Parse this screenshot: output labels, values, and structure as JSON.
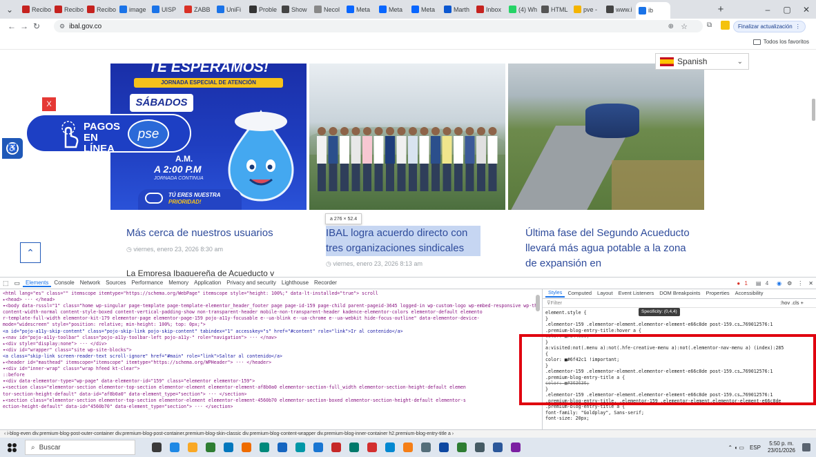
{
  "browser": {
    "tabs": [
      "Recibo",
      "Recibo",
      "Recibo",
      "image",
      "UISP",
      "ZABB",
      "UniFi",
      "Proble",
      "Show",
      "Necol",
      "Meta",
      "Meta",
      "Meta",
      "Marth",
      "Inbox",
      "(4) Wh",
      "HTML",
      "pve -",
      "www.i",
      "ib"
    ],
    "address": "ibal.gov.co",
    "update_button": "Finalizar actualización",
    "bookmarks_label": "Todos los favoritos"
  },
  "page": {
    "language_select": "Spanish",
    "close_badge": "X",
    "banner": {
      "headline_top": "TE ESPERAMOS!",
      "ribbon": "JORNADA ESPECIAL DE ATENCIÓN",
      "day": "SÁBADOS",
      "payments": "PAGOS EN LÍNEA",
      "pse": "pse",
      "time_am": "A.M.",
      "time_pm": "A 2:00 P.M",
      "continuous": "JORNADA CONTINUA",
      "priority_line1": "TÚ ERES NUESTRA",
      "priority_line2": "PRIORIDAD!"
    },
    "size_tooltip": "a  276 × 52.4",
    "posts": [
      {
        "title": "Más cerca de nuestros usuarios",
        "date": "viernes, enero 23, 2026 8:30 am",
        "excerpt": "La Empresa Ibaguereña de Acueducto y"
      },
      {
        "title": "IBAL logra acuerdo directo con tres organizaciones sindicales",
        "date": "viernes, enero 23, 2026 8:13 am"
      },
      {
        "title": "Última fase del Segundo Acueducto llevará más agua potable a la zona de expansión en",
        "date": ""
      }
    ]
  },
  "devtools": {
    "tabs": [
      "Elements",
      "Console",
      "Network",
      "Sources",
      "Performance",
      "Memory",
      "Application",
      "Privacy and security",
      "Lighthouse",
      "Recorder"
    ],
    "badges": {
      "errors": "1",
      "warnings": "4"
    },
    "dom_lines": [
      "<html lang=\"es\" class=\"\" itemscope itemtype=\"https://schema.org/WebPage\" itemscope style=\"height: 100%;\" data-lt-installed=\"true\"> scroll",
      "▸<head> ··· </head>",
      "▾<body data-rsssl=\"1\" class=\"home wp-singular page-template page-template-elementor_header_footer page page-id-159 page-child parent-pageid-3645 logged-in wp-custom-logo wp-embed-responsive wp-theme-kadence ehf-header ehf-footer ehf-template-kadence ehf-stylesheet-kadence social-brand-colors link-style-standard has-sidebar content-title-style-above",
      "content-width-normal content-style-boxed content-vertical-padding-show non-transparent-header mobile-non-transparent-header kadence-elementor-colors elementor-default elemento",
      "r-template-full-width elementor-kit-179 elementor-page elementor-page-159 pojo-a11y-focusable e--ua-blink e--ua-chrome e--ua-webkit hide-focus-outline\" data-elementor-device-",
      "mode=\"widescreen\" style=\"position: relative; min-height: 100%; top: 0px;\">",
      "  <a id=\"pojo-a11y-skip-content\" class=\"pojo-skip-link pojo-skip-content\" tabindex=\"1\" accesskey=\"s\" href=\"#content\" role=\"link\">Ir al contenido</a>",
      "  ▸<nav id=\"pojo-a11y-toolbar\" class=\"pojo-a11y-toolbar-left pojo-a11y-\" role=\"navigation\"> ··· </nav>",
      "  ▸<div style=\"display:none\"> ··· </div>",
      "  ▾<div id=\"wrapper\" class=\"site wp-site-blocks\">",
      "     <a class=\"skip-link screen-reader-text scroll-ignore\" href=\"#main\" role=\"link\">Saltar al contenido</a>",
      "    ▸<header id=\"masthead\" itemscope=\"itemscope\" itemtype=\"https://schema.org/WPHeader\"> ··· </header>",
      "    ▾<div id=\"inner-wrap\" class=\"wrap hfeed kt-clear\">",
      "       ::before",
      "      ▾<div data-elementor-type=\"wp-page\" data-elementor-id=\"159\" class=\"elementor elementor-159\">",
      "        ▸<section class=\"elementor-section elementor-top-section elementor-element elementor-element-af8b0a0 elementor-section-full_width elementor-section-height-default elemen",
      "          tor-section-height-default\" data-id=\"af8b0a0\" data-element_type=\"section\"> ··· </section>",
      "        ▸<section class=\"elementor-section elementor-top-section elementor-element elementor-element-4560b70 elementor-section-boxed elementor-section-height-default elementor-s",
      "          ection-height-default\" data-id=\"4560b70\" data-element_type=\"section\"> ··· </section>"
    ],
    "styles_tabs": [
      "Styles",
      "Computed",
      "Layout",
      "Event Listeners",
      "DOM Breakpoints",
      "Properties",
      "Accessibility"
    ],
    "filter_placeholder": "Filter",
    "filter_tools": ":hov .cls +",
    "styles_lines": [
      "element.style {",
      "}",
      ".elementor-159 .elementor-element.elementor-element-e66c8de   post-159.cs…769012576:1",
      ".premium-blog-entry-title:hover a {",
      "  color: ■#344080;",
      "}",
      "a:visited:not(.menu a):not(.hfe-creative-menu a):not(.elementor-nav-menu a)   (index):285",
      "{",
      "  color: ■#6f42c1 !important;",
      "}",
      ".elementor-159 .elementor-element.elementor-element-e66c8de   post-159.cs…769012576:1",
      ".premium-blog-entry-title a {",
      "  color: ■#363636;",
      "}",
      ".elementor-159 .elementor-element.elementor-element-e66c8de   post-159.cs…769012576:1",
      ".premium-blog-entry-title, .elementor-159 .elementor-element.elementor-element-e66c8de",
      ".premium-blog-entry-title a {",
      "  font-family: \"Goldplay\", Sans-serif;",
      "  font-size: 20px;"
    ],
    "specificity_tooltip": "Specificity: (0,4,4)",
    "breadcrumbs": "‹ i-blog-even   div.premium-blog-post-outer-container   div.premium-blog-post-container.premium-blog-skin-classic   div.premium-blog-content-wrapper   div.premium-blog-inner-container   h2.premium-blog-entry-title   a ›"
  },
  "taskbar": {
    "search_placeholder": "Buscar",
    "lang": "ESP",
    "time": "5:50 p. m.",
    "date": "23/01/2026"
  },
  "colors": {
    "highlight_box": "#e0000e",
    "link": "#2e4b9b",
    "selection": "#c6d6f2"
  }
}
